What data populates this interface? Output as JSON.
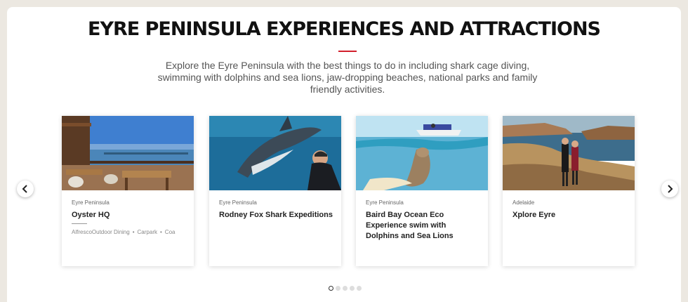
{
  "section": {
    "title": "EYRE PENINSULA EXPERIENCES AND ATTRACTIONS",
    "intro": "Explore the Eyre Peninsula with the best things to do in including shark cage diving, swimming with dolphins and sea lions, jaw-dropping beaches, national parks and family friendly activities.",
    "accent_color": "#d21f2b"
  },
  "carousel": {
    "prev_icon": "chevron-left-icon",
    "next_icon": "chevron-right-icon",
    "active_page": 1,
    "page_count": 5,
    "cards": [
      {
        "region": "Eyre Peninsula",
        "title": "Oyster HQ",
        "tags": [
          "AlfrescoOutdoor Dining",
          "Carpark",
          "Coa"
        ],
        "image": "restaurant-deck-photo"
      },
      {
        "region": "Eyre Peninsula",
        "title": "Rodney Fox Shark Expeditions",
        "tags": [],
        "image": "shark-diver-photo"
      },
      {
        "region": "Eyre Peninsula",
        "title": "Baird Bay Ocean Eco Experience swim with Dolphins and Sea Lions",
        "tags": [],
        "image": "sea-lion-photo"
      },
      {
        "region": "Adelaide",
        "title": "Xplore Eyre",
        "tags": [],
        "image": "coastal-cliffs-couple-photo"
      }
    ]
  }
}
